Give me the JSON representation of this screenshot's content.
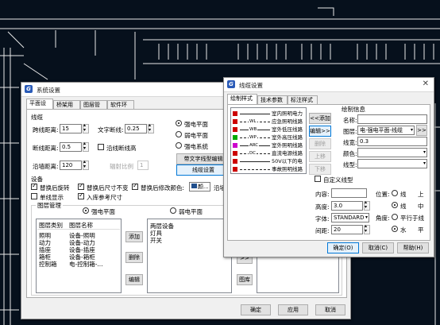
{
  "sys_dialog": {
    "title": "系统设置",
    "tabs": [
      "平面设计",
      "桥架用途",
      "图层管理",
      "软件环境"
    ],
    "section_line": "线缆",
    "fields": {
      "jumpline_label": "跨线距离:",
      "jumpline_value": "15",
      "breakline_label": "断线距离:",
      "breakline_value": "0.5",
      "alongwall_label": "沿墙距离:",
      "alongwall_value": "120",
      "textbreak_label": "文字断线:",
      "textbreak_value": "0.25",
      "breakline_hl_label": "沿线断线高",
      "arrange_ratio_label": "辐射比例",
      "arrange_ratio_value": "1"
    },
    "radios": [
      "强电平面",
      "弱电平面",
      "强电系统"
    ],
    "btn_text_linetype": "带文字线型编辑",
    "btn_line_setting": "线缆设置",
    "section_equip": "设备",
    "equip_checks": {
      "replace_after_rot": "替换后旋转",
      "replace_size_keep": "替换后尺寸不变",
      "change_color": "替换后修改颜色:",
      "color_value": "颜...",
      "along_wall": "沿墙距",
      "show_line": "单线显示",
      "ref_size": "入库参考尺寸"
    },
    "section_layer_mgmt": "图层管理",
    "mgmt_radios": [
      "强电平面",
      "弱电平面"
    ],
    "table_headers": [
      "图层类别",
      "图层名称"
    ],
    "table_rows": [
      [
        "照明",
        "设备-照明"
      ],
      [
        "动力",
        "设备-动力"
      ],
      [
        "插座",
        "设备-插座"
      ],
      [
        "箱柜",
        "设备-箱柜"
      ],
      [
        "控制箱",
        "电-控制箱-..."
      ]
    ],
    "side_buttons": [
      "添加",
      "删除",
      "编辑"
    ],
    "middle_list": [
      "两层设备",
      "灯具",
      "开关"
    ],
    "arrow_btn": ">>",
    "lib_btn": "图库",
    "footer_buttons": [
      "确定",
      "应用",
      "取消"
    ]
  },
  "line_dialog": {
    "title": "线缆设置",
    "tabs": [
      "绘制样式",
      "技术参数",
      "标注样式"
    ],
    "line_styles": [
      {
        "code": "",
        "name": "室内照明电力",
        "color": "#cc0000"
      },
      {
        "code": "WL",
        "name": "应急照明线路",
        "color": "#cc0000"
      },
      {
        "code": "WB",
        "name": "室外低压线路",
        "color": "#cc0000"
      },
      {
        "code": "WP",
        "name": "室外高压线路",
        "color": "#00aa00"
      },
      {
        "code": "ARC",
        "name": "室外照明线路",
        "color": "#cc00cc"
      },
      {
        "code": "DC",
        "name": "直流电源线路",
        "color": "#cc0000"
      },
      {
        "code": "",
        "name": "50V以下的电",
        "color": "#cc0000"
      },
      {
        "code": "",
        "name": "事故照明线路",
        "color": "#cc0000"
      }
    ],
    "mid_buttons": [
      "<<添加",
      "编辑>>",
      "删除",
      "上移",
      "下移"
    ],
    "info_title": "绘制信息",
    "name_label": "名称:",
    "name_value": "",
    "layer_label": "图层:",
    "layer_value": "电-强电平面-线缆",
    "layer_btn": ">>",
    "width_label": "线宽:",
    "width_value": "0.3",
    "color_label": "颜色:",
    "linetype_label": "线型:",
    "custom_check": "自定义线型",
    "content_label": "内容:",
    "height_label": "高度:",
    "height_value": "3.0",
    "font_label": "字体:",
    "font_value": "STANDARD",
    "gap_label": "间距:",
    "gap_value": "20",
    "pos_label": "位置:",
    "pos_options": [
      "线",
      "上",
      "线",
      "中"
    ],
    "angle_label": "角度:",
    "angle_options": [
      "平行于线",
      "水",
      "平"
    ],
    "footer_buttons": [
      "确定(O)",
      "取消(C)",
      "帮助(H)"
    ]
  }
}
